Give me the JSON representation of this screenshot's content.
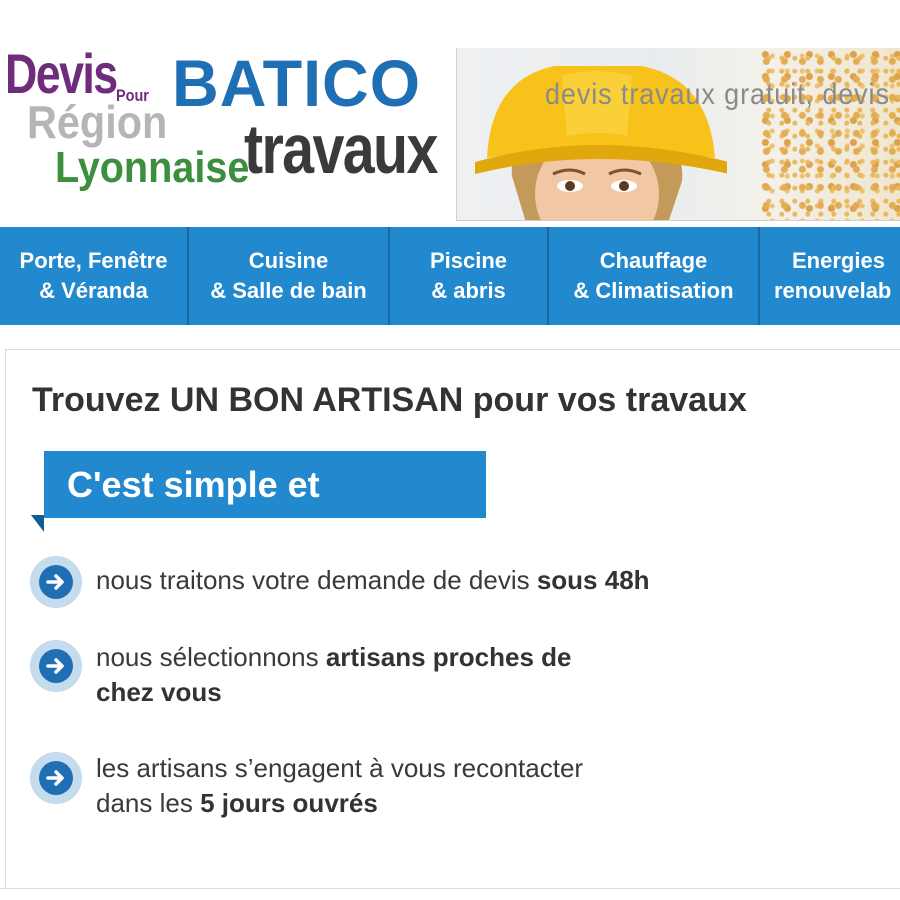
{
  "logo": {
    "devis": "Devis",
    "pour": "Pour",
    "region": "Région",
    "lyonnaise": "Lyonnaise",
    "batico": "BATICO",
    "travaux": "travaux"
  },
  "banner": {
    "slogan": "devis travaux gratuit, devis"
  },
  "nav": {
    "items": [
      {
        "line1": "Porte, Fenêtre",
        "line2": "& Véranda"
      },
      {
        "line1": "Cuisine",
        "line2": "& Salle de bain"
      },
      {
        "line1": "Piscine",
        "line2": "& abris"
      },
      {
        "line1": "Chauffage",
        "line2": "& Climatisation"
      },
      {
        "line1": "Energies",
        "line2": "renouvelab"
      }
    ]
  },
  "content": {
    "headline": "Trouvez UN BON ARTISAN pour vos travaux",
    "ribbon": "C'est simple et",
    "bullets": [
      {
        "line1_normal": "nous traitons votre demande de devis ",
        "line1_bold": "sous 48h"
      },
      {
        "line1_normal": "nous sélectionnons ",
        "line1_bold": "artisans proches de",
        "line2_bold": "chez vous"
      },
      {
        "line1_normal": "les artisans s’engagent à vous recontacter",
        "line2_normal": "dans les ",
        "line2_bold": "5 jours ouvrés"
      }
    ]
  },
  "colors": {
    "nav_bg": "#2289cf",
    "ribbon_bg": "#2289cf",
    "logo_purple": "#6e2c7a",
    "logo_blue": "#1f6fb5",
    "logo_green": "#3c8f3c",
    "text_dark": "#333333"
  },
  "icons": {
    "bullet": "arrow-right-circle-icon"
  }
}
